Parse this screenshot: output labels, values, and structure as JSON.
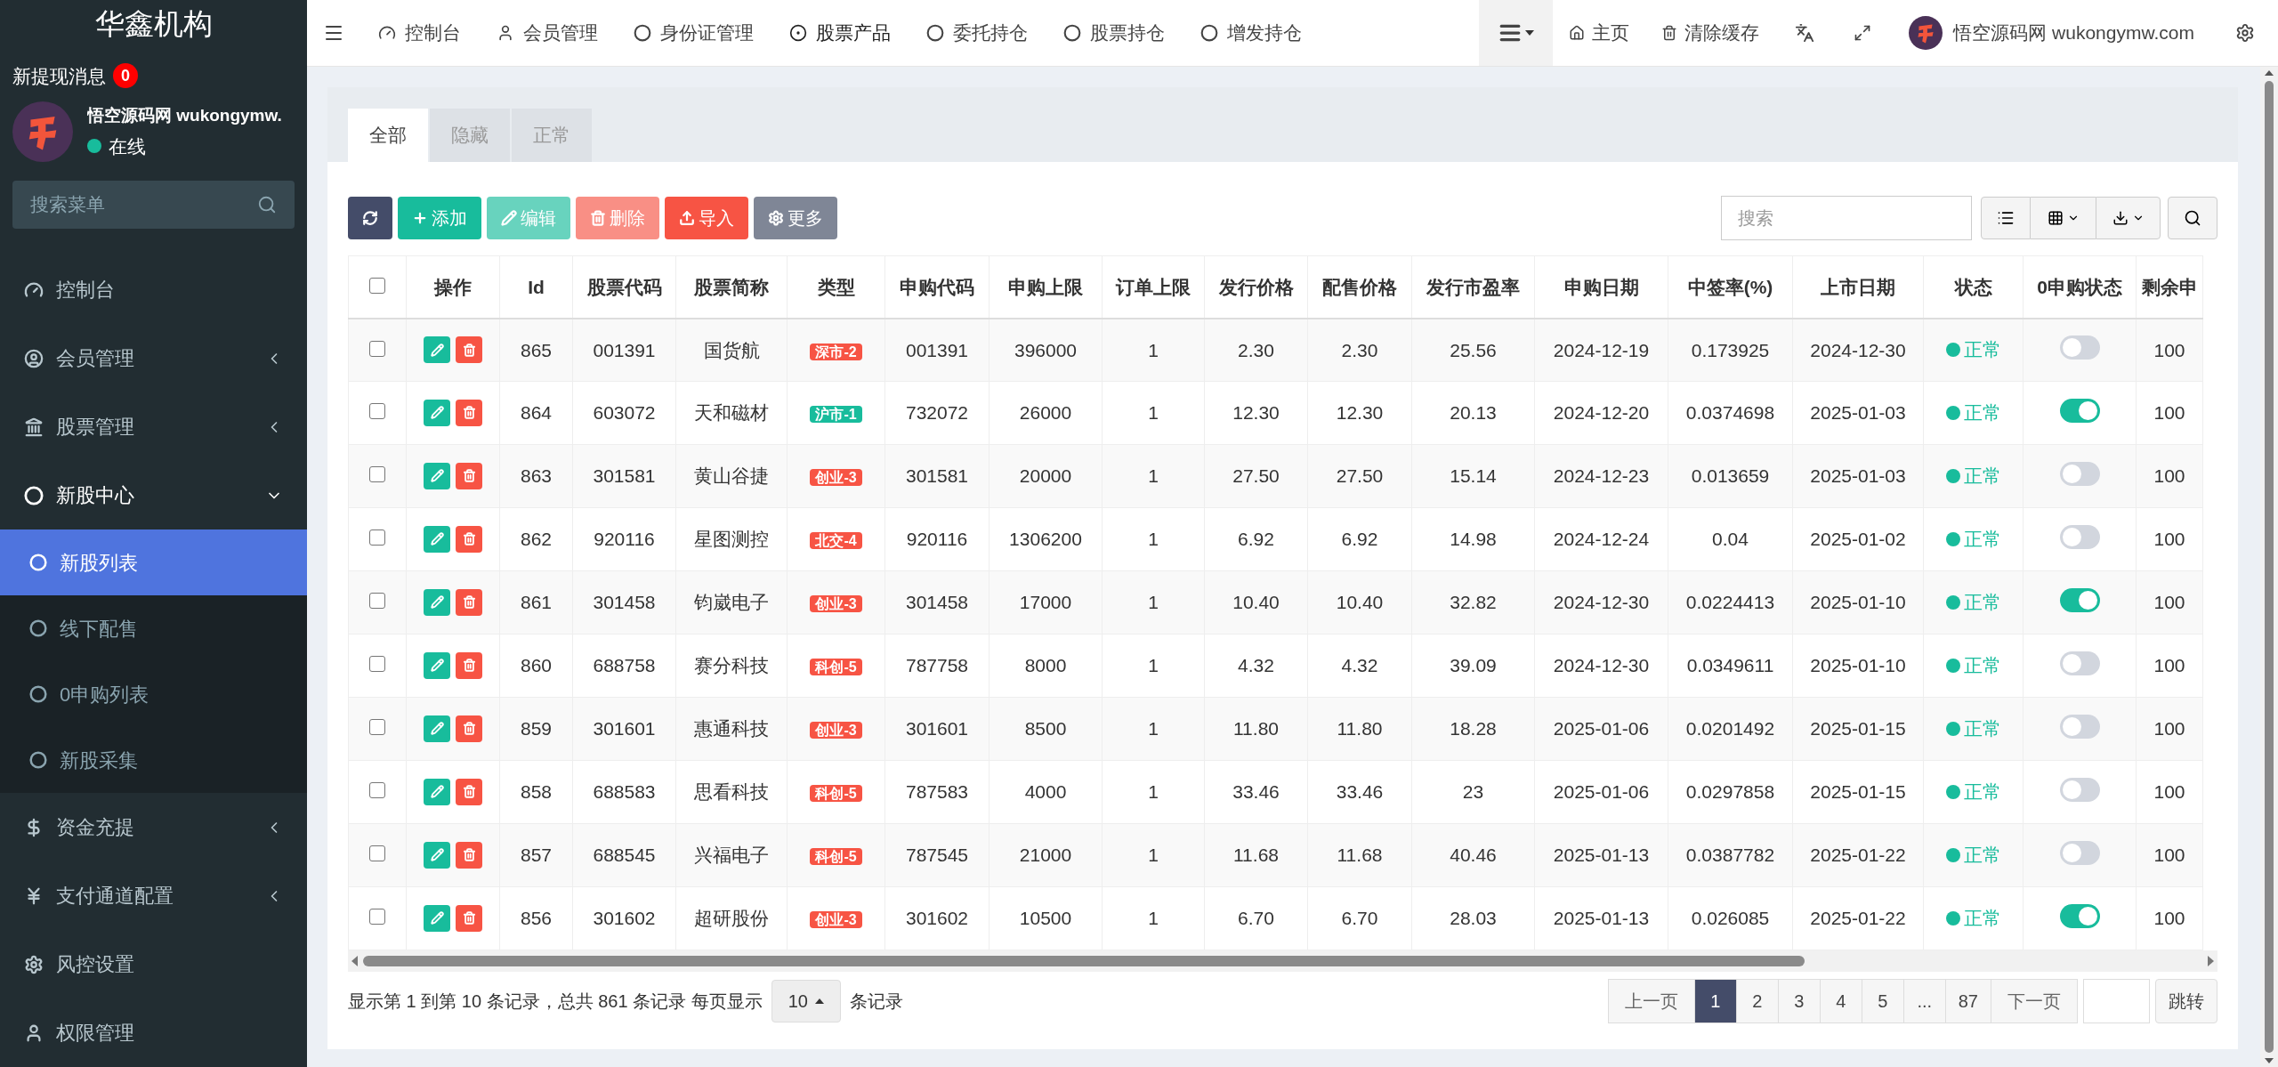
{
  "sidebar": {
    "brand": "华鑫机构",
    "notice": {
      "label": "新提现消息",
      "count": "0"
    },
    "user": {
      "name": "悟空源码网 wukongymw.",
      "status": "在线"
    },
    "search": {
      "placeholder": "搜索菜单"
    },
    "items": [
      {
        "label": "控制台"
      },
      {
        "label": "会员管理",
        "expanded": false
      },
      {
        "label": "股票管理",
        "expanded": false
      },
      {
        "label": "新股中心",
        "expanded": true,
        "children": [
          {
            "label": "新股列表",
            "selected": true
          },
          {
            "label": "线下配售",
            "selected": false
          },
          {
            "label": "0申购列表",
            "selected": false
          },
          {
            "label": "新股采集",
            "selected": false
          }
        ]
      },
      {
        "label": "资金充提",
        "expanded": false
      },
      {
        "label": "支付通道配置",
        "expanded": false
      },
      {
        "label": "风控设置"
      },
      {
        "label": "权限管理"
      }
    ]
  },
  "topbar": {
    "tabs": [
      {
        "label": "控制台",
        "selected": false
      },
      {
        "label": "会员管理",
        "selected": false
      },
      {
        "label": "身份证管理",
        "selected": false
      },
      {
        "label": "股票产品",
        "selected": true
      },
      {
        "label": "委托持仓",
        "selected": false
      },
      {
        "label": "股票持仓",
        "selected": false
      },
      {
        "label": "增发持仓",
        "selected": false
      }
    ],
    "links": [
      "主页",
      "清除缓存"
    ],
    "user": "悟空源码网 wukongymw.com"
  },
  "card_tabs": [
    {
      "label": "全部",
      "selected": true
    },
    {
      "label": "隐藏",
      "selected": false
    },
    {
      "label": "正常",
      "selected": false
    }
  ],
  "toolbar": {
    "buttons": [
      {
        "disabled": false
      },
      {
        "label": "添加",
        "disabled": false
      },
      {
        "label": "编辑",
        "disabled": true
      },
      {
        "label": "删除",
        "disabled": true
      },
      {
        "label": "导入",
        "disabled": false
      },
      {
        "label": "更多",
        "disabled": false
      }
    ],
    "search": {
      "placeholder": "搜索"
    }
  },
  "table": {
    "select_all_checked": false,
    "columns": [
      "操作",
      "Id",
      "股票代码",
      "股票简称",
      "类型",
      "申购代码",
      "申购上限",
      "订单上限",
      "发行价格",
      "配售价格",
      "发行市盈率",
      "申购日期",
      "中签率(%)",
      "上市日期",
      "状态",
      "0申购状态",
      "剩余申"
    ],
    "rows": [
      {
        "checked": false,
        "id": "865",
        "code": "001391",
        "name": "国货航",
        "type": {
          "label": "深市-2",
          "color": "#f75444"
        },
        "sub_code": "001391",
        "limit": "396000",
        "order_limit": "1",
        "price": "2.30",
        "placing_price": "2.30",
        "pe": "25.56",
        "sub_date": "2024-12-19",
        "rate": "0.173925",
        "list_date": "2024-12-30",
        "status": "正常",
        "zero_on": false,
        "remaining": "100"
      },
      {
        "checked": false,
        "id": "864",
        "code": "603072",
        "name": "天和磁材",
        "type": {
          "label": "沪市-1",
          "color": "#18bc9c"
        },
        "sub_code": "732072",
        "limit": "26000",
        "order_limit": "1",
        "price": "12.30",
        "placing_price": "12.30",
        "pe": "20.13",
        "sub_date": "2024-12-20",
        "rate": "0.0374698",
        "list_date": "2025-01-03",
        "status": "正常",
        "zero_on": true,
        "remaining": "100"
      },
      {
        "checked": false,
        "id": "863",
        "code": "301581",
        "name": "黄山谷捷",
        "type": {
          "label": "创业-3",
          "color": "#f75444"
        },
        "sub_code": "301581",
        "limit": "20000",
        "order_limit": "1",
        "price": "27.50",
        "placing_price": "27.50",
        "pe": "15.14",
        "sub_date": "2024-12-23",
        "rate": "0.013659",
        "list_date": "2025-01-03",
        "status": "正常",
        "zero_on": false,
        "remaining": "100"
      },
      {
        "checked": false,
        "id": "862",
        "code": "920116",
        "name": "星图测控",
        "type": {
          "label": "北交-4",
          "color": "#f75444"
        },
        "sub_code": "920116",
        "limit": "1306200",
        "order_limit": "1",
        "price": "6.92",
        "placing_price": "6.92",
        "pe": "14.98",
        "sub_date": "2024-12-24",
        "rate": "0.04",
        "list_date": "2025-01-02",
        "status": "正常",
        "zero_on": false,
        "remaining": "100"
      },
      {
        "checked": false,
        "id": "861",
        "code": "301458",
        "name": "钧崴电子",
        "type": {
          "label": "创业-3",
          "color": "#f75444"
        },
        "sub_code": "301458",
        "limit": "17000",
        "order_limit": "1",
        "price": "10.40",
        "placing_price": "10.40",
        "pe": "32.82",
        "sub_date": "2024-12-30",
        "rate": "0.0224413",
        "list_date": "2025-01-10",
        "status": "正常",
        "zero_on": true,
        "remaining": "100"
      },
      {
        "checked": false,
        "id": "860",
        "code": "688758",
        "name": "赛分科技",
        "type": {
          "label": "科创-5",
          "color": "#f75444"
        },
        "sub_code": "787758",
        "limit": "8000",
        "order_limit": "1",
        "price": "4.32",
        "placing_price": "4.32",
        "pe": "39.09",
        "sub_date": "2024-12-30",
        "rate": "0.0349611",
        "list_date": "2025-01-10",
        "status": "正常",
        "zero_on": false,
        "remaining": "100"
      },
      {
        "checked": false,
        "id": "859",
        "code": "301601",
        "name": "惠通科技",
        "type": {
          "label": "创业-3",
          "color": "#f75444"
        },
        "sub_code": "301601",
        "limit": "8500",
        "order_limit": "1",
        "price": "11.80",
        "placing_price": "11.80",
        "pe": "18.28",
        "sub_date": "2025-01-06",
        "rate": "0.0201492",
        "list_date": "2025-01-15",
        "status": "正常",
        "zero_on": false,
        "remaining": "100"
      },
      {
        "checked": false,
        "id": "858",
        "code": "688583",
        "name": "思看科技",
        "type": {
          "label": "科创-5",
          "color": "#f75444"
        },
        "sub_code": "787583",
        "limit": "4000",
        "order_limit": "1",
        "price": "33.46",
        "placing_price": "33.46",
        "pe": "23",
        "sub_date": "2025-01-06",
        "rate": "0.0297858",
        "list_date": "2025-01-15",
        "status": "正常",
        "zero_on": false,
        "remaining": "100"
      },
      {
        "checked": false,
        "id": "857",
        "code": "688545",
        "name": "兴福电子",
        "type": {
          "label": "科创-5",
          "color": "#f75444"
        },
        "sub_code": "787545",
        "limit": "21000",
        "order_limit": "1",
        "price": "11.68",
        "placing_price": "11.68",
        "pe": "40.46",
        "sub_date": "2025-01-13",
        "rate": "0.0387782",
        "list_date": "2025-01-22",
        "status": "正常",
        "zero_on": false,
        "remaining": "100"
      },
      {
        "checked": false,
        "id": "856",
        "code": "301602",
        "name": "超研股份",
        "type": {
          "label": "创业-3",
          "color": "#f75444"
        },
        "sub_code": "301602",
        "limit": "10500",
        "order_limit": "1",
        "price": "6.70",
        "placing_price": "6.70",
        "pe": "28.03",
        "sub_date": "2025-01-13",
        "rate": "0.026085",
        "list_date": "2025-01-22",
        "status": "正常",
        "zero_on": true,
        "remaining": "100"
      }
    ]
  },
  "footer": {
    "summary": "显示第 1 到第 10 条记录，总共 861 条记录 每页显示",
    "page_size": "10",
    "suffix": "条记录"
  },
  "pagination": {
    "prev": "上一页",
    "pages": [
      {
        "label": "1",
        "selected": true
      },
      {
        "label": "2",
        "selected": false
      },
      {
        "label": "3",
        "selected": false
      },
      {
        "label": "4",
        "selected": false
      },
      {
        "label": "5",
        "selected": false
      },
      {
        "label": "...",
        "selected": false
      },
      {
        "label": "87",
        "selected": false
      }
    ],
    "next": "下一页",
    "jump": "跳转"
  }
}
